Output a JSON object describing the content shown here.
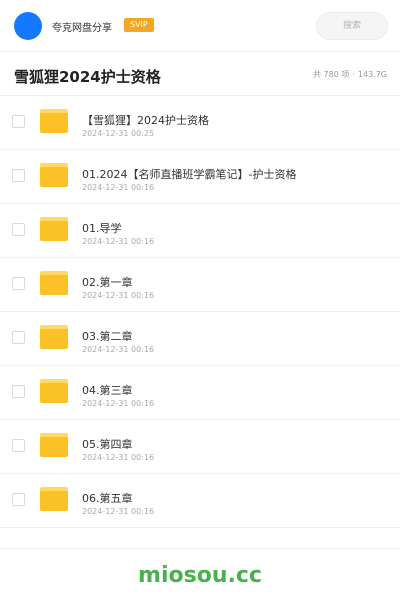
{
  "header": {
    "app_name": "夸克网盘分享",
    "badge": "SVIP",
    "search_placeholder": "搜索"
  },
  "folder": {
    "title": "雪狐狸2024护士资格",
    "count_text": "共 780 项",
    "separator": "·",
    "size_text": "143.7G"
  },
  "files": [
    {
      "name": "【雪狐狸】2024护士资格",
      "date": "2024-12-31 00:25"
    },
    {
      "name": "01.2024【名师直播班学霸笔记】-护士资格",
      "date": "2024-12-31 00:16"
    },
    {
      "name": "01.导学",
      "date": "2024-12-31 00:16"
    },
    {
      "name": "02.第一章",
      "date": "2024-12-31 00:16"
    },
    {
      "name": "03.第二章",
      "date": "2024-12-31 00:16"
    },
    {
      "name": "04.第三章",
      "date": "2024-12-31 00:16"
    },
    {
      "name": "05.第四章",
      "date": "2024-12-31 00:16"
    },
    {
      "name": "06.第五章",
      "date": "2024-12-31 00:16"
    }
  ],
  "footer": {
    "watermark": "miosou.cc"
  },
  "colors": {
    "avatar": "#1677ff",
    "badge": "#f5a623",
    "folder": "#fbc227",
    "watermark": "#4caf50"
  },
  "icons": {
    "folder": "folder-icon",
    "checkbox": "checkbox"
  }
}
